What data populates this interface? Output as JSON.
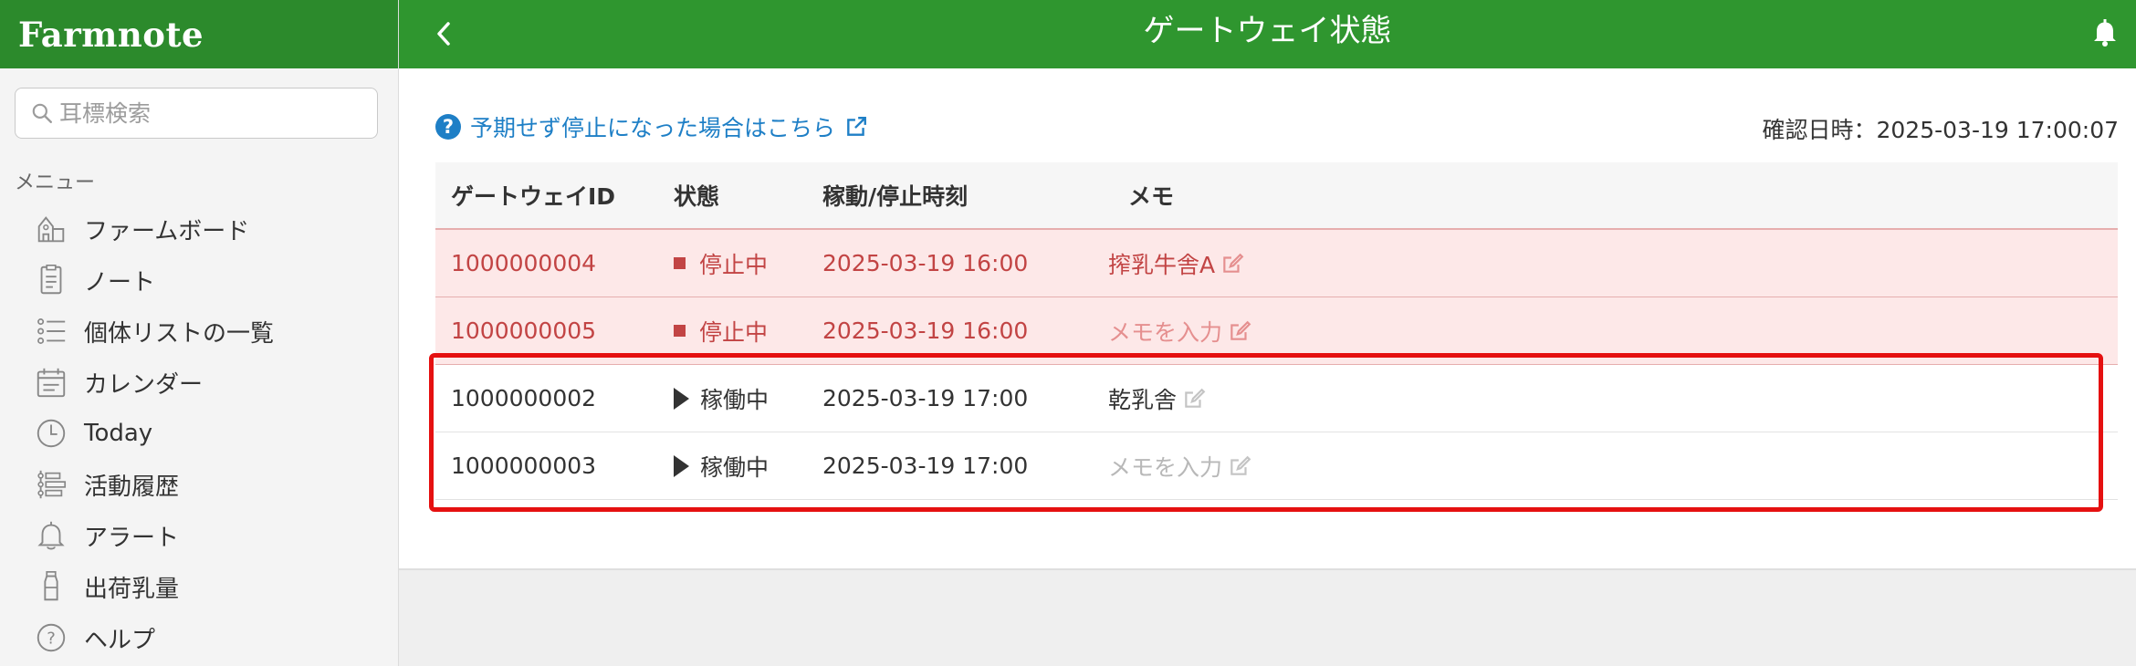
{
  "sidebar": {
    "logo": "Farmnote",
    "search_placeholder": "耳標検索",
    "menu_heading": "メニュー",
    "items": [
      {
        "label": "ファームボード",
        "icon": "farm-icon"
      },
      {
        "label": "ノート",
        "icon": "note-icon"
      },
      {
        "label": "個体リストの一覧",
        "icon": "list-icon"
      },
      {
        "label": "カレンダー",
        "icon": "calendar-icon"
      },
      {
        "label": "Today",
        "icon": "clock-icon"
      },
      {
        "label": "活動履歴",
        "icon": "history-icon"
      },
      {
        "label": "アラート",
        "icon": "bell-icon"
      },
      {
        "label": "出荷乳量",
        "icon": "milk-bottle-icon"
      },
      {
        "label": "ヘルプ",
        "icon": "help-icon"
      }
    ]
  },
  "header": {
    "title": "ゲートウェイ状態"
  },
  "panel": {
    "help_link": "予期せず停止になった場合はこちら",
    "confirm_label": "確認日時：2025-03-19 17:00:07",
    "table": {
      "columns": [
        "ゲートウェイID",
        "状態",
        "稼動/停止時刻",
        "メモ"
      ],
      "rows": [
        {
          "id": "1000000004",
          "status": "停止中",
          "time": "2025-03-19 16:00",
          "memo": "搾乳牛舎A",
          "state": "stopped",
          "memo_is_placeholder": false
        },
        {
          "id": "1000000005",
          "status": "停止中",
          "time": "2025-03-19 16:00",
          "memo": "メモを入力",
          "state": "stopped",
          "memo_is_placeholder": true
        },
        {
          "id": "1000000002",
          "status": "稼働中",
          "time": "2025-03-19 17:00",
          "memo": "乾乳舎",
          "state": "running",
          "memo_is_placeholder": false
        },
        {
          "id": "1000000003",
          "status": "稼働中",
          "time": "2025-03-19 17:00",
          "memo": "メモを入力",
          "state": "running",
          "memo_is_placeholder": true
        }
      ]
    }
  },
  "colors": {
    "header_green": "#2f962f",
    "stopped_red": "#c24444",
    "stopped_bg": "#fde8e8",
    "link_blue": "#1e7fc6",
    "highlight_red": "#e51010"
  }
}
